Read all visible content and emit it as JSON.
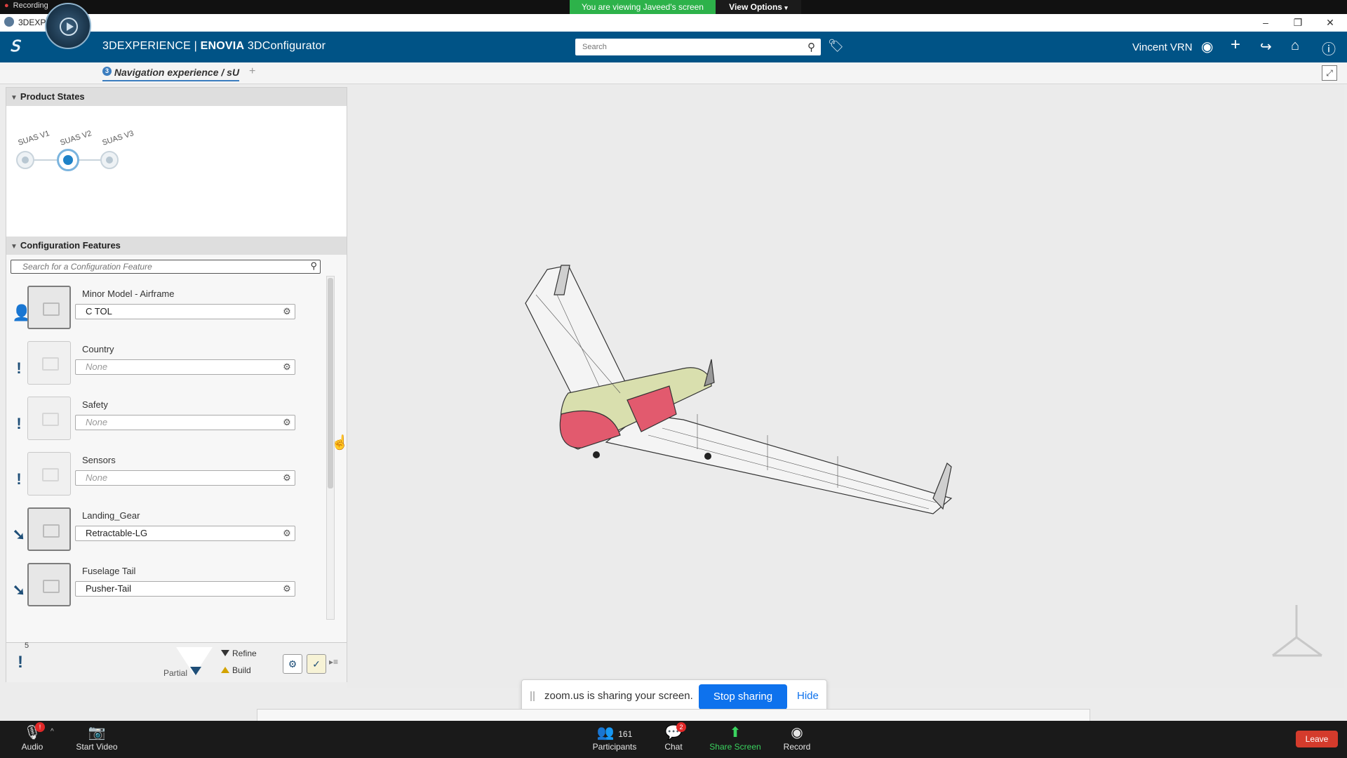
{
  "zoom_top": {
    "recording_label": "Recording",
    "viewing_banner": "You are viewing Javeed's screen",
    "view_options_label": "View Options"
  },
  "window": {
    "title": "3DEXPERIENCE",
    "minimize": "–",
    "restore": "❐",
    "close": "✕"
  },
  "app": {
    "brand_prefix": "3DEXPERIENCE |",
    "brand_app": "ENOVIA",
    "brand_product": "3DConfigurator",
    "search_placeholder": "Search",
    "user_name": "Vincent VRN",
    "tab_label": "Navigation experience / sU",
    "tab_badge": "3",
    "tab_add": "+"
  },
  "product_states": {
    "title": "Product States",
    "states": [
      {
        "label": "SUAS V1",
        "active": false
      },
      {
        "label": "SUAS V2",
        "active": true
      },
      {
        "label": "SUAS V3",
        "active": false
      }
    ]
  },
  "config_features": {
    "title": "Configuration Features",
    "search_placeholder": "Search for a Configuration Feature",
    "features": [
      {
        "name": "Minor Model - Airframe",
        "value": "C TOL",
        "status": "user-icon",
        "status_glyph": "👤",
        "none": false,
        "selected": true
      },
      {
        "name": "Country",
        "value": "None",
        "status": "required-icon",
        "status_glyph": "!",
        "none": true,
        "selected": false
      },
      {
        "name": "Safety",
        "value": "None",
        "status": "required-icon",
        "status_glyph": "!",
        "none": true,
        "selected": false
      },
      {
        "name": "Sensors",
        "value": "None",
        "status": "required-icon",
        "status_glyph": "!",
        "none": true,
        "selected": false
      },
      {
        "name": "Landing_Gear",
        "value": "Retractable-LG",
        "status": "rule-arrow-icon",
        "status_glyph": "➘",
        "none": false,
        "selected": true
      },
      {
        "name": "Fuselage Tail",
        "value": "Pusher-Tail",
        "status": "rule-arrow-icon",
        "status_glyph": "➘",
        "none": false,
        "selected": true
      }
    ],
    "bottom_count": "5",
    "partial_label": "Partial",
    "refine_label": "Refine",
    "build_label": "Build"
  },
  "zoom_share": {
    "message": "zoom.us is sharing your screen.",
    "stop_label": "Stop sharing",
    "hide_label": "Hide"
  },
  "zoom_bottom": {
    "audio": "Audio",
    "audio_badge": "!",
    "video": "Start Video",
    "participants": "Participants",
    "participants_count": "161",
    "chat": "Chat",
    "chat_badge": "2",
    "share": "Share Screen",
    "record": "Record",
    "leave": "Leave"
  },
  "colors": {
    "header_blue": "#005386",
    "share_green": "#2db24a",
    "zoom_blue": "#0e72ed",
    "leave_red": "#d43b2c"
  }
}
